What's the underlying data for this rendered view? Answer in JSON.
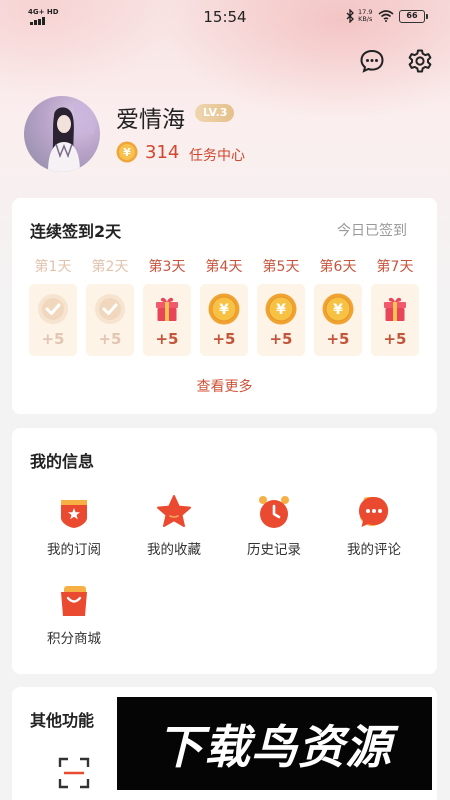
{
  "status_bar": {
    "network": "4G+ HD",
    "time": "15:54",
    "speed_value": "17.9",
    "speed_unit": "KB/s",
    "battery": "66"
  },
  "header": {
    "message_icon": "chat-bubble-icon",
    "settings_icon": "gear-icon"
  },
  "profile": {
    "username": "爱情海",
    "level": "LV.3",
    "coins": "314",
    "task_link": "任务中心"
  },
  "checkin": {
    "title": "连续签到2天",
    "status": "今日已签到",
    "see_more": "查看更多",
    "days": [
      {
        "label": "第1天",
        "points": "+5",
        "icon": "check-icon",
        "state": "done"
      },
      {
        "label": "第2天",
        "points": "+5",
        "icon": "check-icon",
        "state": "done"
      },
      {
        "label": "第3天",
        "points": "+5",
        "icon": "gift-icon",
        "state": "todo"
      },
      {
        "label": "第4天",
        "points": "+5",
        "icon": "yuan-coin-icon",
        "state": "todo"
      },
      {
        "label": "第5天",
        "points": "+5",
        "icon": "yuan-coin-icon",
        "state": "todo"
      },
      {
        "label": "第6天",
        "points": "+5",
        "icon": "yuan-coin-icon",
        "state": "todo"
      },
      {
        "label": "第7天",
        "points": "+5",
        "icon": "gift-icon",
        "state": "todo"
      }
    ]
  },
  "my_info": {
    "title": "我的信息",
    "items": [
      {
        "label": "我的订阅",
        "icon": "subscription-icon"
      },
      {
        "label": "我的收藏",
        "icon": "star-icon"
      },
      {
        "label": "历史记录",
        "icon": "clock-icon"
      },
      {
        "label": "我的评论",
        "icon": "comment-icon"
      },
      {
        "label": "积分商城",
        "icon": "shopping-bag-icon"
      }
    ]
  },
  "other": {
    "title": "其他功能",
    "scan_icon": "scan-icon"
  },
  "watermark": {
    "text": "下载鸟资源"
  },
  "colors": {
    "accent": "#d2462e",
    "card_bg": "#ffffff",
    "page_bg": "#f3f3f3",
    "reward_tile": "#fdf3e6"
  }
}
